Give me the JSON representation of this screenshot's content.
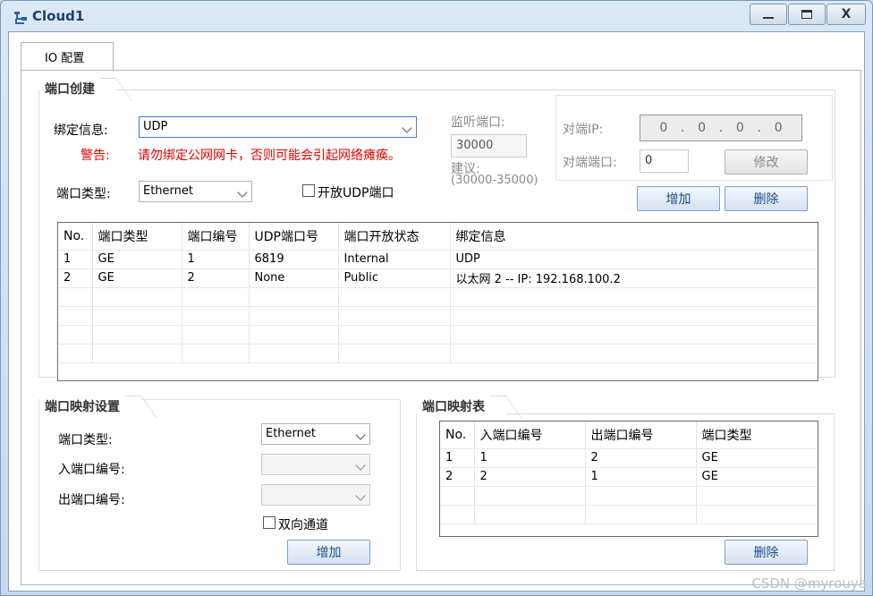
{
  "window": {
    "title": "Cloud1",
    "icons": {
      "app": "cloud-network-icon",
      "minimize": "minimize-icon",
      "maximize": "maximize-icon",
      "close": "close-icon"
    },
    "close_label": "X"
  },
  "tabs": [
    {
      "label": "IO 配置"
    }
  ],
  "port_create": {
    "title": "端口创建",
    "binding_label": "绑定信息:",
    "binding_value": "UDP",
    "warning_label": "警告:",
    "warning_text": "请勿绑定公网网卡，否则可能会引起网络瘫痪。",
    "port_type_label": "端口类型:",
    "port_type_value": "Ethernet",
    "open_udp_label": "开放UDP端口",
    "open_udp_checked": false,
    "listen_port_label": "监听端口:",
    "listen_port_value": "30000",
    "suggest_label": "建议:",
    "suggest_range": "(30000-35000)",
    "peer_ip_label": "对端IP:",
    "peer_ip_octets": [
      "0",
      "0",
      "0",
      "0"
    ],
    "peer_port_label": "对端端口:",
    "peer_port_value": "0",
    "modify_label": "修改",
    "add_label": "增加",
    "delete_label": "删除",
    "table": {
      "columns": [
        "No.",
        "端口类型",
        "端口编号",
        "UDP端口号",
        "端口开放状态",
        "绑定信息"
      ],
      "rows": [
        [
          "1",
          "GE",
          "1",
          "6819",
          "Internal",
          "UDP"
        ],
        [
          "2",
          "GE",
          "2",
          "None",
          "Public",
          "以太网 2 -- IP: 192.168.100.2"
        ]
      ]
    }
  },
  "port_map_settings": {
    "title": "端口映射设置",
    "port_type_label": "端口类型:",
    "port_type_value": "Ethernet",
    "in_port_label": "入端口编号:",
    "in_port_value": "",
    "out_port_label": "出端口编号:",
    "out_port_value": "",
    "bidirectional_label": "双向通道",
    "bidirectional_checked": false,
    "add_label": "增加"
  },
  "port_map_table": {
    "title": "端口映射表",
    "columns": [
      "No.",
      "入端口编号",
      "出端口编号",
      "端口类型"
    ],
    "rows": [
      [
        "1",
        "1",
        "2",
        "GE"
      ],
      [
        "2",
        "2",
        "1",
        "GE"
      ]
    ],
    "delete_label": "删除"
  },
  "watermark": "CSDN @myrouya"
}
